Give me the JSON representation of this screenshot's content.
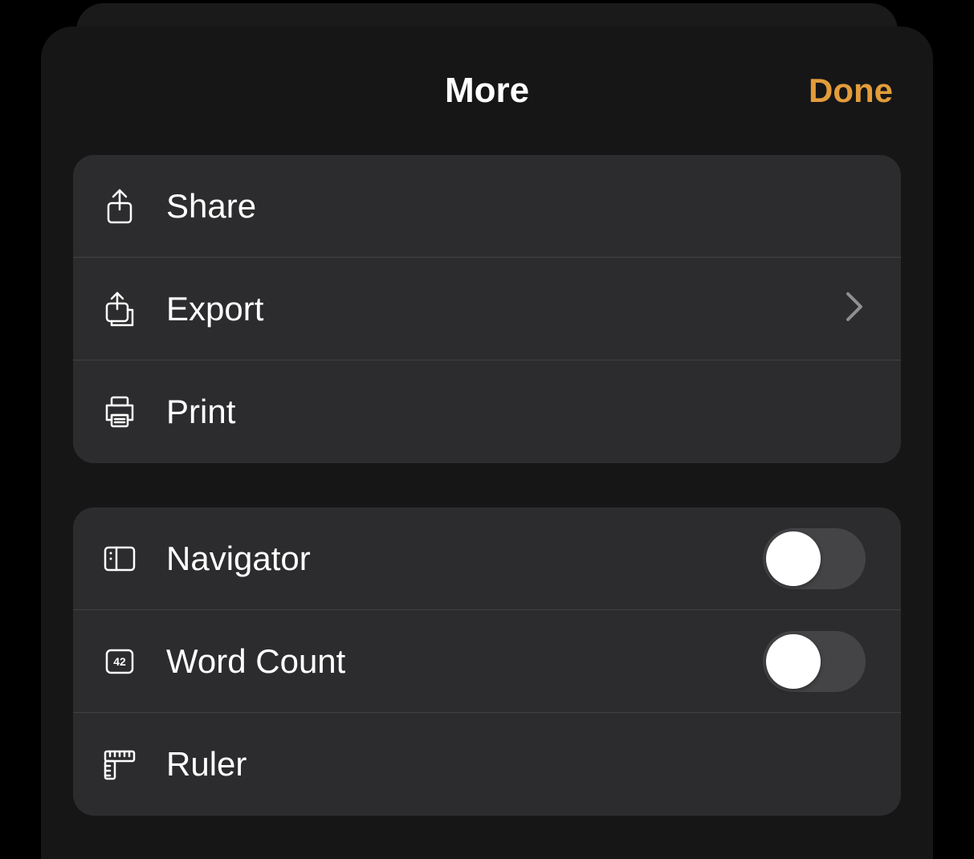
{
  "header": {
    "title": "More",
    "done_label": "Done",
    "accent_color": "#e39c3b"
  },
  "groups": [
    {
      "type": "actions",
      "items": [
        {
          "id": "share",
          "icon": "share-icon",
          "label": "Share",
          "disclosure": false
        },
        {
          "id": "export",
          "icon": "export-icon",
          "label": "Export",
          "disclosure": true
        },
        {
          "id": "print",
          "icon": "print-icon",
          "label": "Print",
          "disclosure": false
        }
      ]
    },
    {
      "type": "toggles",
      "items": [
        {
          "id": "navigator",
          "icon": "navigator-icon",
          "label": "Navigator",
          "toggle": false
        },
        {
          "id": "word_count",
          "icon": "word-count-icon",
          "label": "Word Count",
          "toggle": false
        },
        {
          "id": "ruler",
          "icon": "ruler-icon",
          "label": "Ruler"
        }
      ]
    }
  ]
}
